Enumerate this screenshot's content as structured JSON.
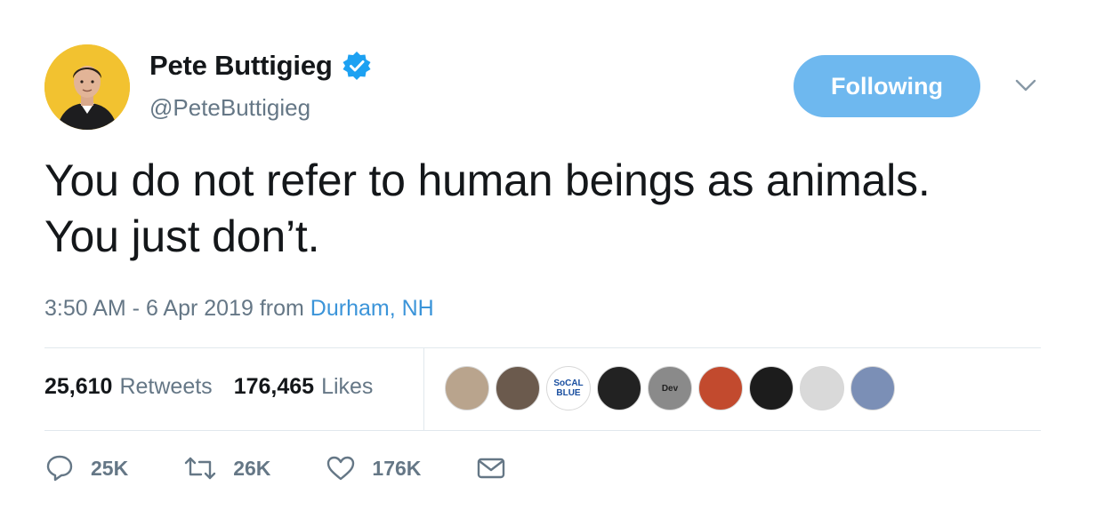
{
  "user": {
    "display_name": "Pete Buttigieg",
    "handle": "@PeteButtigieg",
    "verified": true
  },
  "follow_button": {
    "label": "Following",
    "color": "#6eb8ef"
  },
  "tweet": {
    "lines": [
      "You do not refer to human beings as animals.",
      "You just don’t."
    ],
    "time": "3:50 AM - 6 Apr 2019",
    "from_label": "from",
    "location": "Durham, NH"
  },
  "stats": {
    "retweets_count": "25,610",
    "retweets_label": "Retweets",
    "likes_count": "176,465",
    "likes_label": "Likes"
  },
  "likers": [
    {
      "icon": "avatar-photo",
      "bg": "#b9a48d",
      "text": ""
    },
    {
      "icon": "avatar-photo",
      "bg": "#6b5a4d",
      "text": ""
    },
    {
      "icon": "avatar-logo",
      "bg": "#ffffff",
      "text": "SoCAL BLUE",
      "color": "#1a4fa0"
    },
    {
      "icon": "avatar-photo",
      "bg": "#222222",
      "text": ""
    },
    {
      "icon": "avatar-logo",
      "bg": "#8a8a8a",
      "text": "Dev",
      "color": "#222222"
    },
    {
      "icon": "avatar-photo",
      "bg": "#c24a2e",
      "text": ""
    },
    {
      "icon": "avatar-photo",
      "bg": "#1c1c1c",
      "text": ""
    },
    {
      "icon": "avatar-photo",
      "bg": "#d9d9d9",
      "text": ""
    },
    {
      "icon": "avatar-photo",
      "bg": "#7b8fb6",
      "text": ""
    }
  ],
  "actions": {
    "reply_count": "25K",
    "retweet_count": "26K",
    "like_count": "176K"
  },
  "colors": {
    "text": "#14171a",
    "secondary": "#657786",
    "link": "#3b94d9",
    "verified": "#1da1f2",
    "divider": "#e1e8ed"
  }
}
